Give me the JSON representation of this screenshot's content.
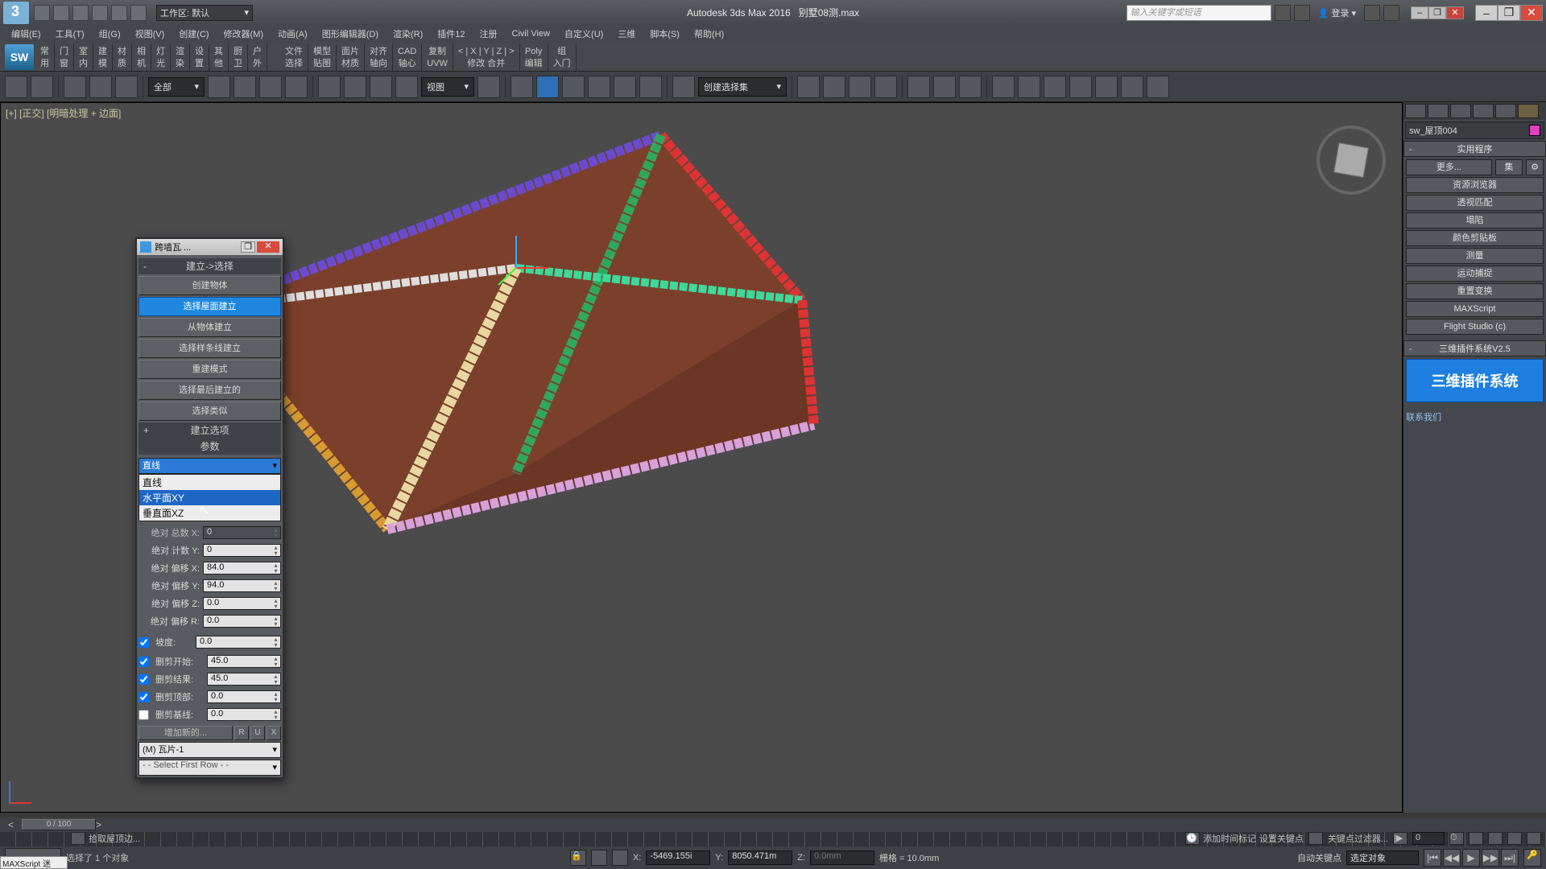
{
  "app": {
    "name": "Autodesk 3ds Max 2016",
    "doc": "别墅08测.max"
  },
  "titlebar": {
    "workspace_label": "工作区: 默认",
    "search_placeholder": "输入关键字或短语",
    "login": "登录"
  },
  "menu": [
    "编辑(E)",
    "工具(T)",
    "组(G)",
    "视图(V)",
    "创建(C)",
    "修改器(M)",
    "动画(A)",
    "图形编辑器(D)",
    "渲染(R)",
    "插件12",
    "注册",
    "Civil View",
    "自定义(U)",
    "三维",
    "脚本(S)",
    "帮助(H)"
  ],
  "ribbon": {
    "tabs": [
      {
        "top": "常",
        "bot": "用"
      },
      {
        "top": "门",
        "bot": "窗"
      },
      {
        "top": "室",
        "bot": "内"
      },
      {
        "top": "建",
        "bot": "模"
      },
      {
        "top": "材",
        "bot": "质"
      },
      {
        "top": "相",
        "bot": "机"
      },
      {
        "top": "灯",
        "bot": "光"
      },
      {
        "top": "渲",
        "bot": "染"
      },
      {
        "top": "设",
        "bot": "置"
      },
      {
        "top": "其",
        "bot": "他"
      },
      {
        "top": "厨",
        "bot": "卫"
      },
      {
        "top": "户",
        "bot": "外"
      }
    ],
    "tabs2": [
      {
        "top": "文件",
        "bot": "选择"
      },
      {
        "top": "模型",
        "bot": "贴图"
      },
      {
        "top": "面片",
        "bot": "材质"
      },
      {
        "top": "对齐",
        "bot": "轴向"
      },
      {
        "top": "CAD",
        "bot": "轴心"
      },
      {
        "top": "复制",
        "bot": "UVW"
      },
      {
        "top": "< | X | Y | Z | >",
        "bot": "修改   合并"
      },
      {
        "top": "Poly",
        "bot": "编辑"
      },
      {
        "top": "组",
        "bot": "入门"
      }
    ]
  },
  "maintb": {
    "allDrop": "全部",
    "viewDrop": "视图",
    "selSetDrop": "创建选择集"
  },
  "viewport": {
    "label": "[+] [正交] [明暗处理 + 边面]"
  },
  "dialog": {
    "title": "跨墙瓦 ...",
    "roll1_title": "建立->选择",
    "buttons1": [
      "创建物体",
      "选择屋面建立",
      "从物体建立",
      "选择样条线建立",
      "重建模式",
      "选择最后建立的",
      "选择类似"
    ],
    "roll2_title": "建立选项",
    "roll3_title": "参数",
    "combo": {
      "selected": "直线",
      "options": [
        "直线",
        "水平面XY",
        "垂直面XZ"
      ]
    },
    "params": [
      {
        "lab": "绝对 总数 X:",
        "val": "0",
        "en": false
      },
      {
        "lab": "绝对 计数 Y:",
        "val": "0",
        "en": true
      },
      {
        "lab": "绝对 偏移 X:",
        "val": "84.0",
        "en": true
      },
      {
        "lab": "绝对 偏移 Y:",
        "val": "94.0",
        "en": true
      },
      {
        "lab": "绝对 偏移 Z:",
        "val": "0.0",
        "en": true
      },
      {
        "lab": "绝对 偏移 R:",
        "val": "0.0",
        "en": true
      }
    ],
    "slope": {
      "lab": "坡度:",
      "val": "0.0",
      "chk": true
    },
    "cuts": [
      {
        "lab": "删剪开始:",
        "val": "45.0",
        "chk": true
      },
      {
        "lab": "删剪结果:",
        "val": "45.0",
        "chk": true
      },
      {
        "lab": "删剪顶部:",
        "val": "0.0",
        "chk": true
      },
      {
        "lab": "删剪基线:",
        "val": "0.0",
        "chk": false
      }
    ],
    "addRow": {
      "lab": "增加新的...",
      "r": "R",
      "u": "U",
      "x": "X"
    },
    "tile": "(M) 瓦片-1",
    "rowsel": "- - Select First Row - -"
  },
  "cmdpanel": {
    "obj_name": "sw_屋顶004",
    "roll_util": "实用程序",
    "more": "更多...",
    "sets": "集",
    "utils": [
      "资源浏览器",
      "透视匹配",
      "塌陷",
      "颜色剪贴板",
      "测量",
      "运动捕捉",
      "重置变换",
      "MAXScript",
      "Flight Studio (c)"
    ],
    "plugin_title": "三维插件系统V2.5",
    "plugin_big": "三维插件系统",
    "contact": "联系我们"
  },
  "status": {
    "frame": "0 / 100",
    "sel": "选择了 1 个对象",
    "prompt": "拾取屋顶边...",
    "maxscript": "MAXScript 迷",
    "coords": {
      "x": "-5469.155i",
      "y": "8050.471m",
      "z": "0.0mm"
    },
    "grid": "栅格 = 10.0mm",
    "autokey": "自动关键点",
    "selfilter": "选定对象",
    "setkey": "设置关键点",
    "keyfilter": "关键点过滤器...",
    "spinner": "0",
    "addts": "添加时间标记"
  }
}
